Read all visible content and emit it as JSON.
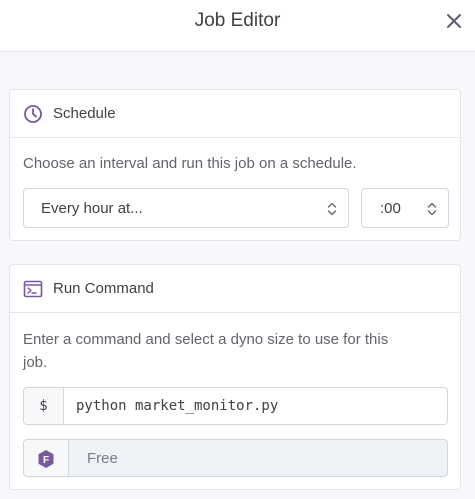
{
  "header": {
    "title": "Job Editor"
  },
  "schedule": {
    "title": "Schedule",
    "description": "Choose an interval and run this job on a schedule.",
    "interval_value": "Every hour at...",
    "minute_value": ":00"
  },
  "run_command": {
    "title": "Run Command",
    "description_line1": "Enter a command and select a dyno size to use for this",
    "description_line2": "job.",
    "prefix": "$",
    "command_value": "python market_monitor.py",
    "dyno_badge": "F",
    "dyno_value": "Free"
  },
  "colors": {
    "accent": "#79589f",
    "text": "#3f3f44"
  }
}
